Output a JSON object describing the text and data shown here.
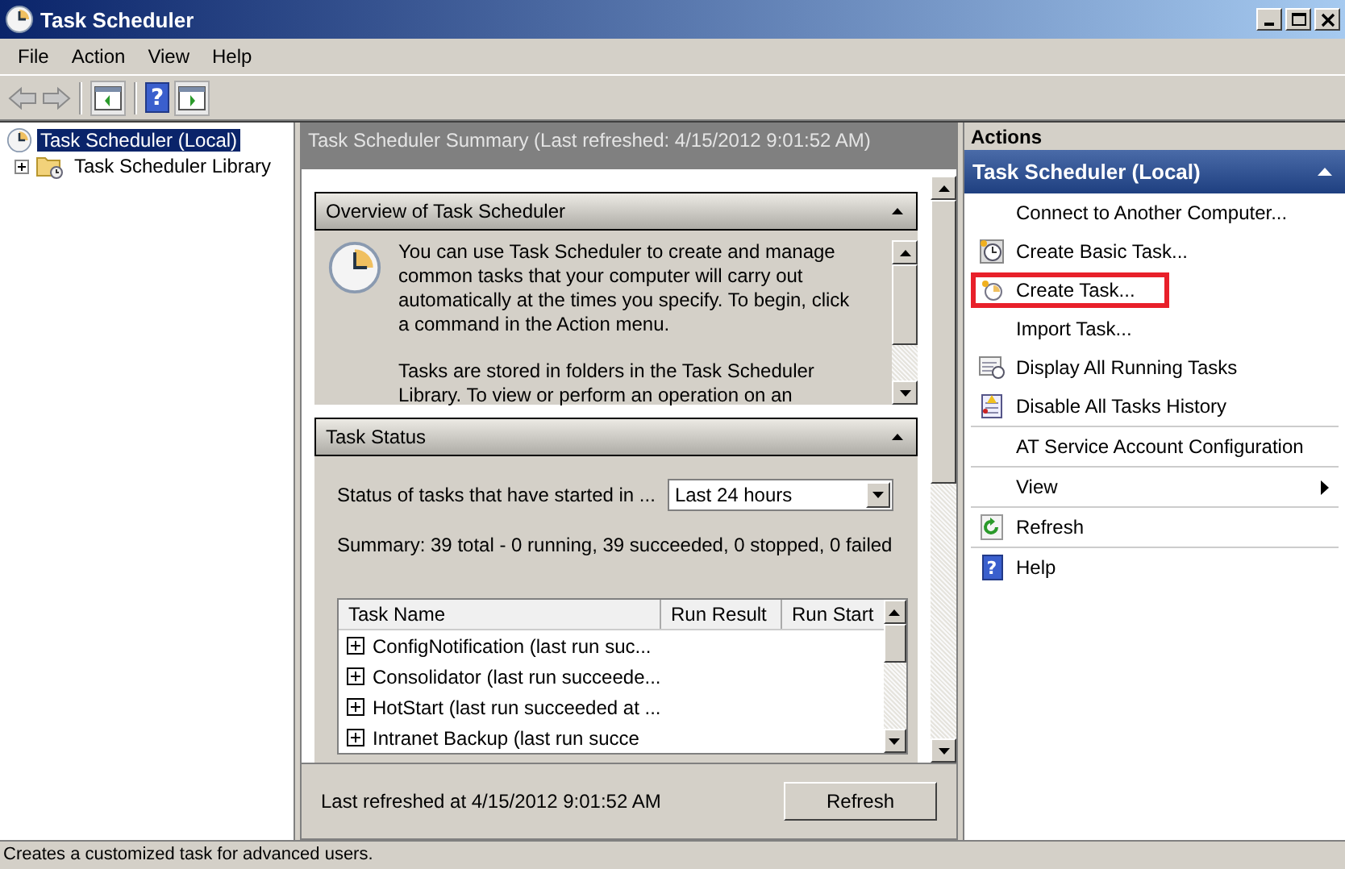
{
  "window": {
    "title": "Task Scheduler"
  },
  "menu": [
    "File",
    "Action",
    "View",
    "Help"
  ],
  "toolbar": {
    "help_glyph": "?"
  },
  "tree": [
    {
      "label": "Task Scheduler (Local)",
      "selected": true,
      "expanded": true,
      "children": [
        {
          "label": "Task Scheduler Library",
          "selected": false,
          "expanded": false
        }
      ]
    }
  ],
  "summary": {
    "header": "Task Scheduler Summary (Last refreshed: 4/15/2012 9:01:52 AM)",
    "overview": {
      "title": "Overview of Task Scheduler",
      "paragraphs": [
        "You can use Task Scheduler to create and manage common tasks that your computer will carry out automatically at the times you specify. To begin, click a command in the Action menu.",
        "Tasks are stored in folders in the Task Scheduler Library. To view or perform an operation on an"
      ]
    },
    "status": {
      "title": "Task Status",
      "filter_label": "Status of tasks that have started in ...",
      "filter_value": "Last 24 hours",
      "summary": "Summary: 39 total - 0 running, 39 succeeded, 0 stopped, 0 failed",
      "columns": [
        "Task Name",
        "Run Result",
        "Run Start"
      ],
      "rows": [
        {
          "name": "ConfigNotification (last run suc...",
          "expanded": false
        },
        {
          "name": "Consolidator (last run succeede...",
          "expanded": false
        },
        {
          "name": "HotStart (last run succeeded at ...",
          "expanded": false
        },
        {
          "name": "Intranet Backup (last run succe",
          "expanded": false
        }
      ]
    },
    "footer": "Last refreshed at 4/15/2012 9:01:52 AM",
    "refresh_button": "Refresh"
  },
  "actions": {
    "title": "Actions",
    "group": "Task Scheduler (Local)",
    "items": [
      {
        "label": "Connect to Another Computer...",
        "highlighted": false,
        "separator": false,
        "submenu": false
      },
      {
        "label": "Create Basic Task...",
        "highlighted": false,
        "separator": false,
        "submenu": false
      },
      {
        "label": "Create Task...",
        "highlighted": true,
        "separator": false,
        "submenu": false
      },
      {
        "label": "Import Task...",
        "highlighted": false,
        "separator": false,
        "submenu": false
      },
      {
        "label": "Display All Running Tasks",
        "highlighted": false,
        "separator": false,
        "submenu": false
      },
      {
        "label": "Disable All Tasks History",
        "highlighted": false,
        "separator": true,
        "submenu": false
      },
      {
        "label": "AT Service Account Configuration",
        "highlighted": false,
        "separator": true,
        "submenu": false
      },
      {
        "label": "View",
        "highlighted": false,
        "separator": true,
        "submenu": true
      },
      {
        "label": "Refresh",
        "highlighted": false,
        "separator": true,
        "submenu": false
      },
      {
        "label": "Help",
        "highlighted": false,
        "separator": false,
        "submenu": false,
        "icon_glyph": "?"
      }
    ]
  },
  "status_bar": "Creates a customized task for advanced users."
}
